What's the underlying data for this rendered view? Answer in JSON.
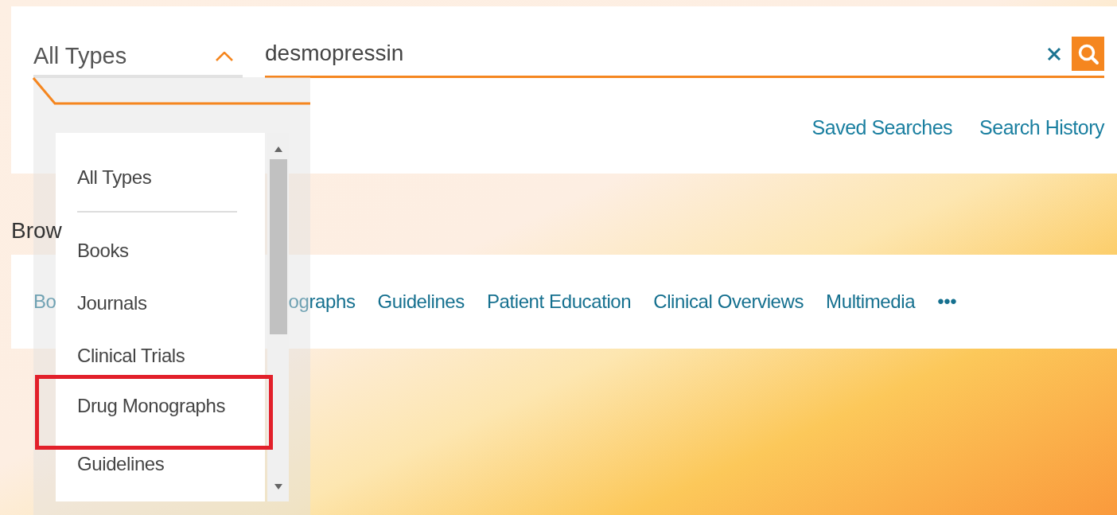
{
  "search": {
    "type_select": {
      "value": "All Types",
      "expanded": true
    },
    "query": "desmopressin"
  },
  "search_links": [
    {
      "label": "Saved Searches"
    },
    {
      "label": "Search History"
    }
  ],
  "browse": {
    "title": "Brow",
    "links": [
      {
        "label": "Bo"
      },
      {
        "label": "ographs"
      },
      {
        "label": "Guidelines"
      },
      {
        "label": "Patient Education"
      },
      {
        "label": "Clinical Overviews"
      },
      {
        "label": "Multimedia"
      },
      {
        "label": "•••"
      }
    ]
  },
  "type_dropdown": {
    "options": [
      {
        "label": "All Types",
        "highlighted": false
      },
      {
        "label": "Books",
        "highlighted": false
      },
      {
        "label": "Journals",
        "highlighted": false
      },
      {
        "label": "Clinical Trials",
        "highlighted": false
      },
      {
        "label": "Drug Monographs",
        "highlighted": true
      },
      {
        "label": "Guidelines",
        "highlighted": false
      }
    ]
  }
}
